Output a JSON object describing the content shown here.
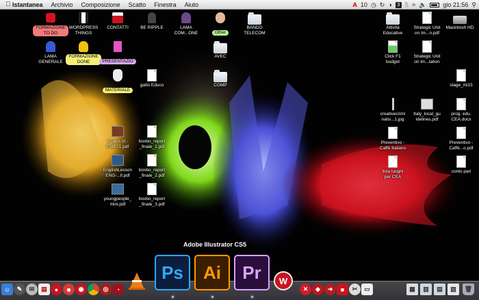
{
  "menubar": {
    "app_name": "Istantanea",
    "menus": [
      "Archivio",
      "Composizione",
      "Scatto",
      "Finestra",
      "Aiuto"
    ],
    "status": {
      "notifications": "10",
      "clock": "gio 21:56",
      "input_badge": "3"
    }
  },
  "desktop": {
    "icons": {
      "formazione_todo": "FORMAZIONE\nTO DO",
      "wordpress": "WORDPRESS\nTHINGS",
      "contatti": "CONTATTI",
      "be_ripple": "BE RIPPLE",
      "lama_comone": "LAMA\nCOM...ONE",
      "other": "Other",
      "bando": "BANDO\nTELECOM",
      "lama_generale": "LAMA\nGENERALE",
      "formazione_done": "FORMAZIONE\nDONE",
      "presentazio": "PRESENTAZIO",
      "avec": "AVEC",
      "materiale": "MATERIALE",
      "gatto": "gatto Educo",
      "cgmp": "CGMP",
      "it_pays": "It pays of -\nFold...1.pdf",
      "boxbo1": "boxbo_report\n_finale_1.pdf",
      "english": "EnglishLesson\nENG-...ll.pdf",
      "boxbo2": "boxbo_report\n_finale_2.pdf",
      "youngpeople": "youngpeople_\nmini.pdf",
      "boxbo3": "boxbo_report\n_finale_3.pdf",
      "attivita": "Attività\nEducative",
      "strategic1": "Strategic Unit\non Im...n.pdf",
      "macintosh": "Macintosh HD",
      "click_f1": "Click F1\nbudget",
      "strategic2": "Strategic Unit\non Im...tation",
      "stage": "stage_mi15",
      "creative": "creativecrimi\nnalsi...1.jpg",
      "italy": "Italy_local_gu\nidelines.pdf",
      "prog": "prog. edu.\nCEA.docx",
      "preventivo1": "Preventivo -\nCaffè Italiano",
      "preventivo2": "Preventivo -\nCaffè...o.pdf",
      "lista": "lista luoghi\nper CEA",
      "conto": "conto pari"
    }
  },
  "dock": {
    "tooltip": "Adobe Illustrator CS5",
    "apps": {
      "ps": "Ps",
      "ai": "Ai",
      "pr": "Pr"
    }
  },
  "colors": {
    "ps_bg": "#0c1e3d",
    "ps_fg": "#31a8ff",
    "ai_bg": "#3b1d00",
    "ai_fg": "#ff9a00",
    "pr_bg": "#2a0f3d",
    "pr_fg": "#d9a3ff",
    "tag_red": "#f07b7b",
    "tag_yellow": "#f3ef7a",
    "tag_green": "#b6ec8f",
    "tag_purple": "#d5a7e8"
  }
}
